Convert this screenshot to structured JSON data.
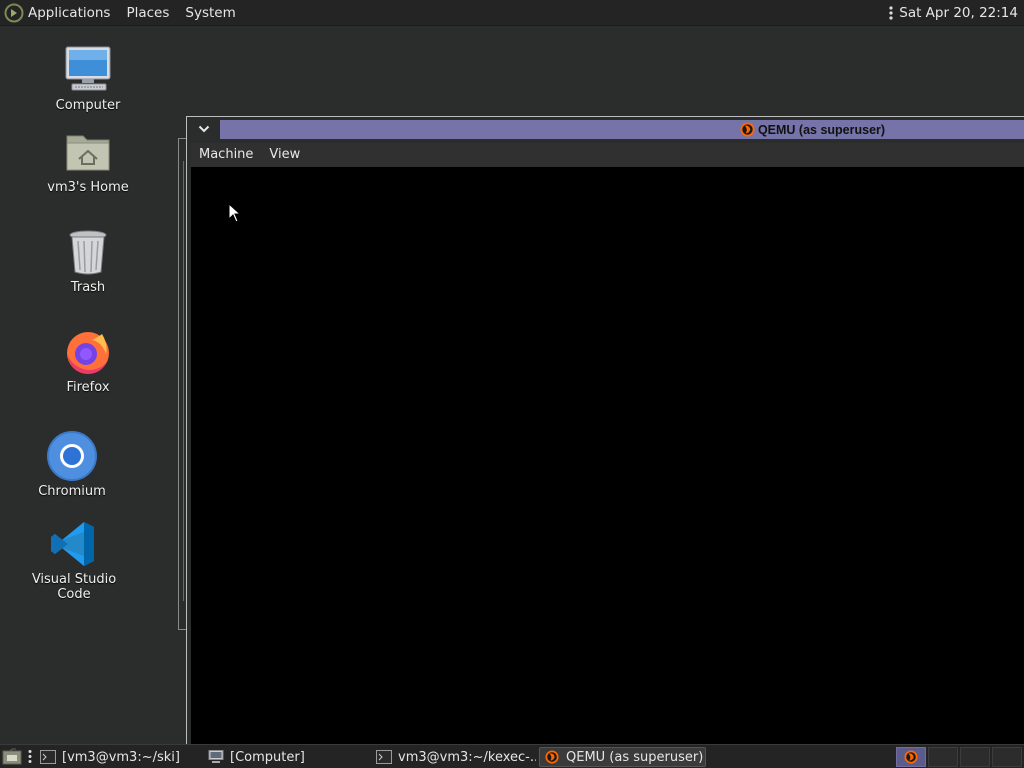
{
  "top_panel": {
    "menus": [
      "Applications",
      "Places",
      "System"
    ],
    "clock": "Sat Apr 20, 22:14"
  },
  "desktop_icons": [
    {
      "label": "Computer",
      "icon": "computer-icon"
    },
    {
      "label": "vm3's Home",
      "icon": "home-folder-icon"
    },
    {
      "label": "Trash",
      "icon": "trash-icon"
    },
    {
      "label": "Firefox",
      "icon": "firefox-icon"
    },
    {
      "label": "Chromium",
      "icon": "chromium-icon"
    },
    {
      "label": "Visual Studio Code",
      "icon": "vscode-icon"
    }
  ],
  "qemu_window": {
    "title": "QEMU (as superuser)",
    "menus": [
      "Machine",
      "View"
    ]
  },
  "taskbar": {
    "tasks": [
      {
        "label": "[vm3@vm3:~/ski]",
        "icon": "terminal-icon",
        "active": false
      },
      {
        "label": "[Computer]",
        "icon": "computer-icon",
        "active": false
      },
      {
        "label": "vm3@vm3:~/kexec-...",
        "icon": "terminal-icon",
        "active": false
      },
      {
        "label": "QEMU (as superuser)",
        "icon": "qemu-icon",
        "active": true
      }
    ]
  },
  "colors": {
    "title_active": "#7573a8",
    "desktop_bg": "#2b2d2c",
    "panel_bg": "#232423"
  }
}
